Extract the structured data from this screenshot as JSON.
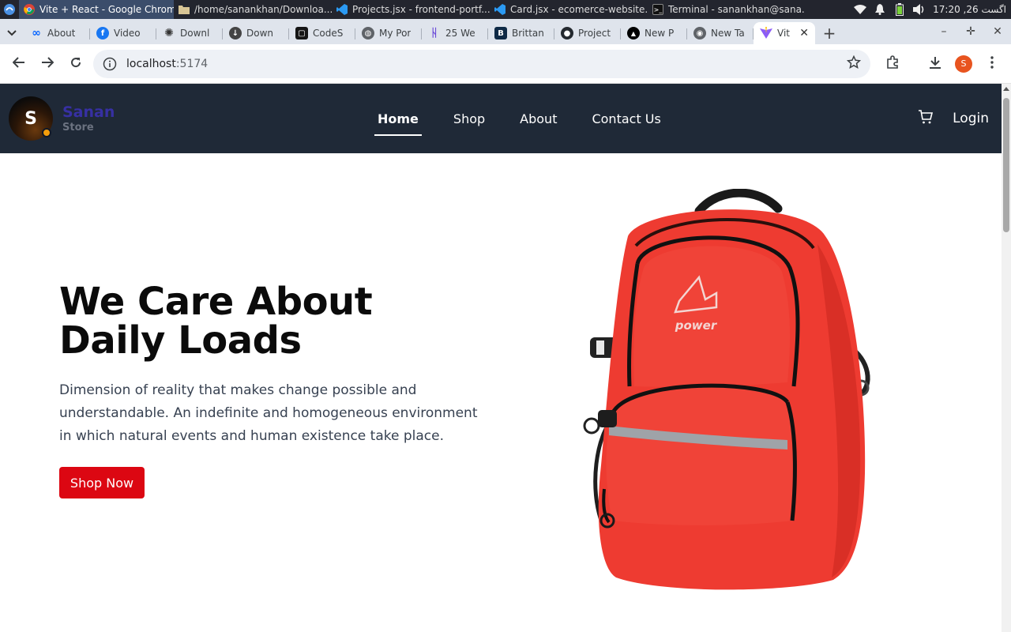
{
  "os": {
    "windows": [
      {
        "label": "Vite + React - Google Chrome",
        "icon": "chrome-icon",
        "active": true
      },
      {
        "label": "/home/sanankhan/Downloa...",
        "icon": "folder-icon",
        "active": false
      },
      {
        "label": "Projects.jsx - frontend-portf...",
        "icon": "vscode-icon",
        "active": false
      },
      {
        "label": "Card.jsx - ecomerce-website...",
        "icon": "vscode-icon",
        "active": false
      },
      {
        "label": "Terminal - sanankhan@sana...",
        "icon": "terminal-icon",
        "active": false
      }
    ],
    "clock": "17:20 ,26 اگست"
  },
  "browser": {
    "tabs": [
      {
        "label": "About",
        "icon": "meta-icon",
        "color": "#0866ff"
      },
      {
        "label": "Video",
        "icon": "facebook-icon",
        "color": "#1877f2"
      },
      {
        "label": "Downl",
        "icon": "openai-icon",
        "color": "#333333"
      },
      {
        "label": "Down",
        "icon": "github-download-icon",
        "color": "#444444"
      },
      {
        "label": "CodeS",
        "icon": "codesandbox-icon",
        "color": "#151515"
      },
      {
        "label": "My Por",
        "icon": "globe-icon",
        "color": "#5f6368"
      },
      {
        "label": "25 We",
        "icon": "web-icon",
        "color": "#6b4bd8"
      },
      {
        "label": "Brittan",
        "icon": "britannica-icon",
        "color": "#0f2a46"
      },
      {
        "label": "Project",
        "icon": "github-icon",
        "color": "#24292f"
      },
      {
        "label": "New P",
        "icon": "vercel-icon",
        "color": "#000000"
      },
      {
        "label": "New Ta",
        "icon": "chrome-icon",
        "color": "#5f6368"
      },
      {
        "label": "Vit",
        "icon": "vite-icon",
        "color": "#8c5cf6",
        "active": true
      }
    ],
    "url_host": "localhost",
    "url_port": ":5174",
    "profile_initial": "S"
  },
  "site": {
    "logo_letter": "S",
    "brand_name": "Sanan",
    "brand_sub": "Store",
    "nav": [
      "Home",
      "Shop",
      "About",
      "Contact Us"
    ],
    "login": "Login",
    "hero_title_line1": "We Care About",
    "hero_title_line2": "Daily Loads",
    "hero_text": "Dimension of reality that makes change possible and understandable. An indefinite and homogeneous environment in which natural events and human existence take place.",
    "cta": "Shop Now",
    "bag_logo_text": "power"
  },
  "colors": {
    "navbar": "#1f2937",
    "cta": "#dc0712",
    "brand": "#3730a3",
    "bag": "#ee3b31"
  }
}
